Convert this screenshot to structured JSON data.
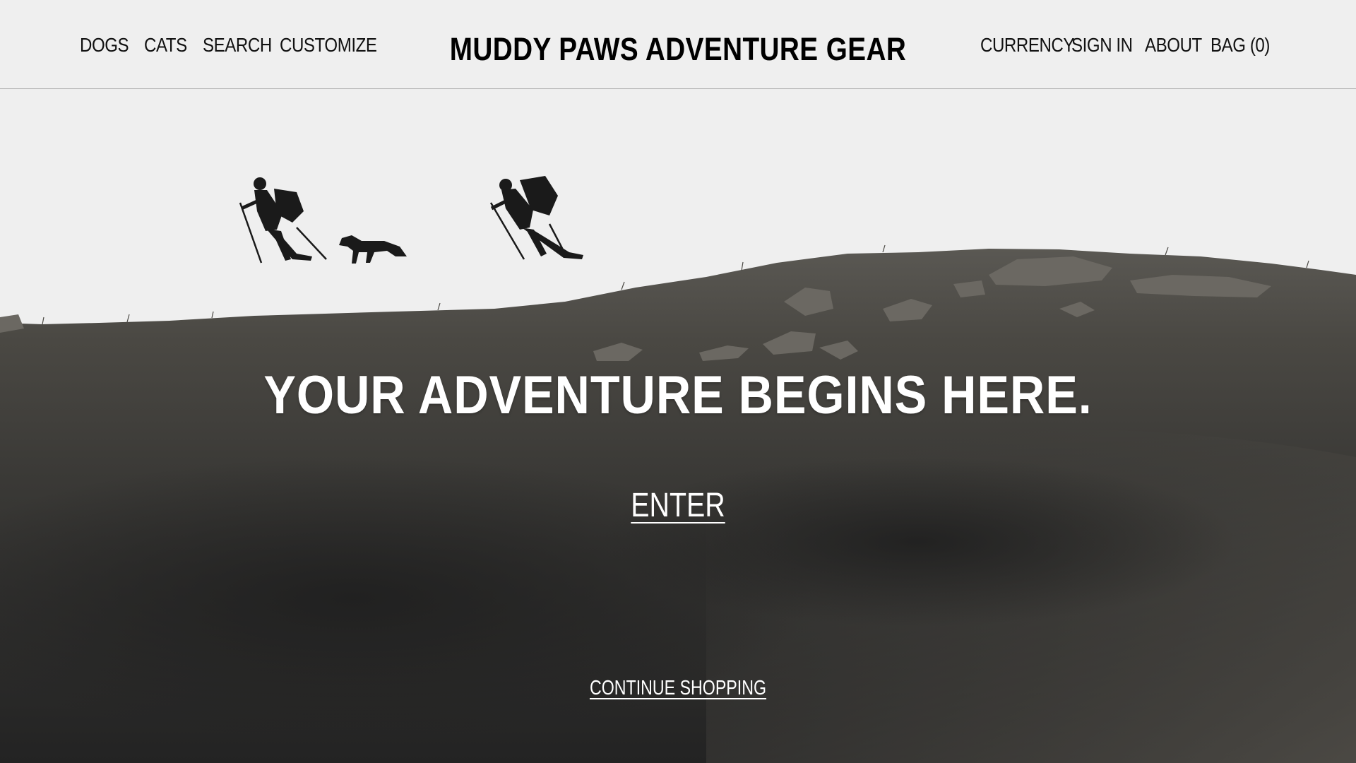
{
  "header": {
    "brand": "MUDDY PAWS ADVENTURE GEAR",
    "left_nav": [
      "DOGS",
      "CATS",
      "SEARCH",
      "CUSTOMIZE"
    ],
    "right_nav": [
      "CURRENCY",
      "SIGN IN",
      "ABOUT",
      "BAG (0)"
    ]
  },
  "hero": {
    "headline": "YOUR ADVENTURE BEGINS HERE.",
    "enter_label": "ENTER",
    "continue_label": "CONTINUE SHOPPING"
  },
  "colors": {
    "header_bg": "#efefef",
    "text_dark": "#111111",
    "text_light": "#ffffff",
    "sky": "#efefef",
    "ground_dark": "#2b2b2b"
  }
}
